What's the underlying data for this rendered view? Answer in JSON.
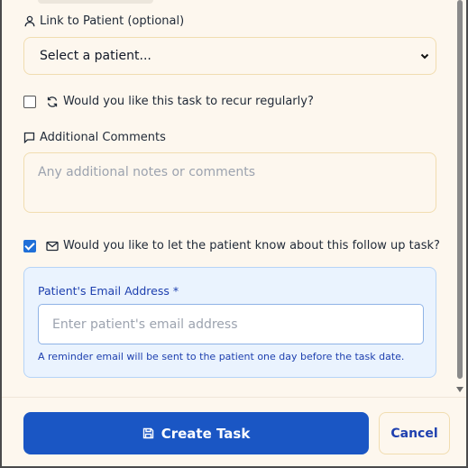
{
  "patient_link": {
    "label": "Link to Patient (optional)",
    "selected": "Select a patient..."
  },
  "recur": {
    "label": "Would you like this task to recur regularly?",
    "checked": false
  },
  "comments": {
    "label": "Additional Comments",
    "placeholder": "Any additional notes or comments"
  },
  "notify": {
    "label": "Would you like to let the patient know about this follow up task?",
    "checked": true
  },
  "email": {
    "label": "Patient's Email Address *",
    "placeholder": "Enter patient's email address",
    "help": "A reminder email will be sent to the patient one day before the task date."
  },
  "footer": {
    "create_label": "Create Task",
    "cancel_label": "Cancel"
  },
  "icons": {
    "patient": "user-icon",
    "recur": "refresh-icon",
    "comments": "message-square-icon",
    "notify": "mail-icon",
    "create": "save-icon",
    "select": "chevron-down-icon"
  },
  "colors": {
    "primary": "#1a56c4",
    "panel_bg": "#eaf3fe",
    "page_bg": "#fdf7ee",
    "accent_text": "#1e40af"
  }
}
